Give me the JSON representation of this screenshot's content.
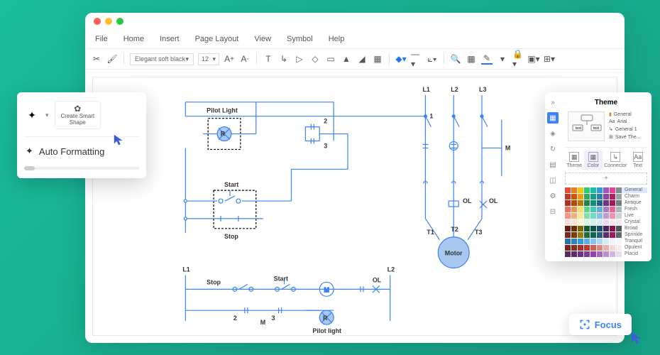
{
  "menu": {
    "file": "File",
    "home": "Home",
    "insert": "Insert",
    "page": "Page Layout",
    "view": "View",
    "symbol": "Symbol",
    "help": "Help"
  },
  "toolbar": {
    "font": "Elegant soft black",
    "size": "12"
  },
  "popup": {
    "smart": "Create Smart\nShape",
    "autofmt": "Auto Formatting"
  },
  "theme": {
    "title": "Theme",
    "list": {
      "general": "General",
      "arial": "Arial",
      "general1": "General 1",
      "save": "Save The..."
    },
    "tabs": {
      "theme": "Theme",
      "color": "Color",
      "connector": "Connector",
      "text": "Text"
    },
    "plus": "+",
    "palettes": [
      "General",
      "Charm",
      "Antique",
      "Fresh",
      "Live",
      "Crystal",
      "Broad",
      "Sprinkle",
      "Tranquil",
      "Opulent",
      "Placid"
    ]
  },
  "focus": "Focus",
  "diagram": {
    "pilot": "Pilot Light",
    "start": "Start",
    "stop": "Stop",
    "motor": "Motor",
    "l1": "L1",
    "l2": "L2",
    "l3": "L3",
    "t1": "T1",
    "t2": "T2",
    "t3": "T3",
    "m": "M",
    "r": "R",
    "ol": "OL",
    "n1": "1",
    "n2": "2",
    "n3": "3",
    "pilot2": "Pilot light"
  }
}
